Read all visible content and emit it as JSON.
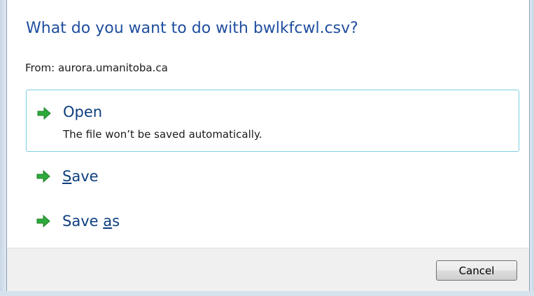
{
  "dialog": {
    "title": "What do you want to do with bwlkfcwl.csv?",
    "from": "From: aurora.umanitoba.ca"
  },
  "options": [
    {
      "label": "Open",
      "description": "The file won’t be saved automatically.",
      "icon": "green-arrow-icon",
      "selected": true
    },
    {
      "label_accel": "S",
      "label_rest": "ave",
      "icon": "green-arrow-icon"
    },
    {
      "label_pre": "Save ",
      "label_accel": "a",
      "label_rest": "s",
      "icon": "green-arrow-icon"
    }
  ],
  "footer": {
    "cancel_label": "Cancel"
  },
  "colors": {
    "title": "#1f4e9e",
    "selected_border": "#7ecfe3",
    "arrow": "#2eaa3a",
    "footer_bg": "#f0f0f0"
  }
}
